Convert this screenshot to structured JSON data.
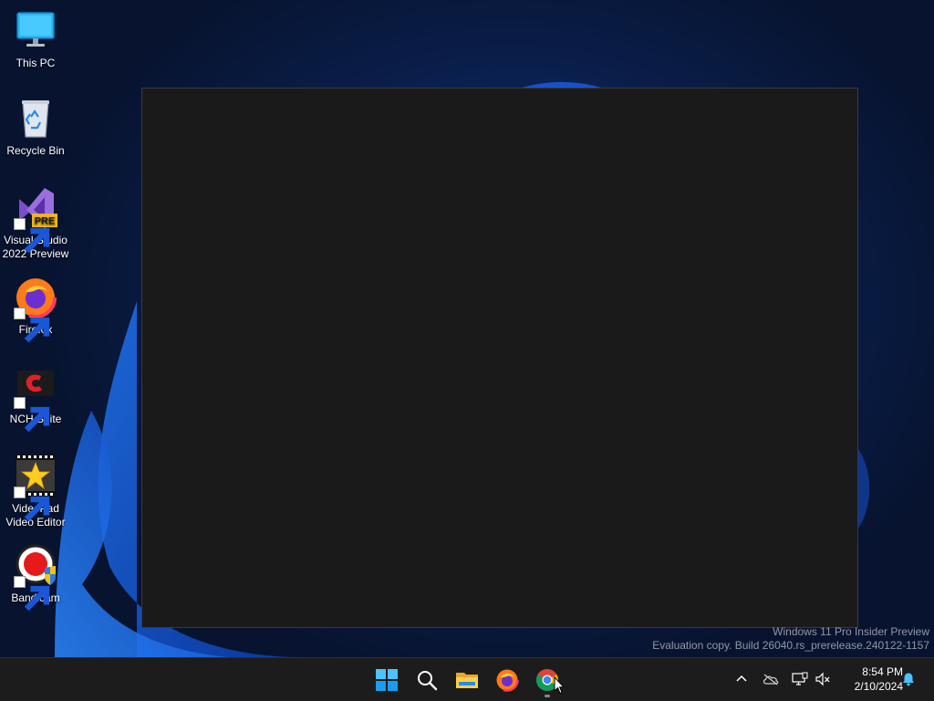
{
  "desktop": {
    "icons": [
      {
        "label": "This PC",
        "icon": "monitor-icon"
      },
      {
        "label": "Recycle Bin",
        "icon": "recycle-bin-icon"
      },
      {
        "label": "Visual Studio\n2022 Preview",
        "icon": "visual-studio-icon",
        "badge": "PRE"
      },
      {
        "label": "Firefox",
        "icon": "firefox-icon"
      },
      {
        "label": "NCH Suite",
        "icon": "nch-suite-icon"
      },
      {
        "label": "VideoPad\nVideo Editor",
        "icon": "videopad-icon"
      },
      {
        "label": "Bandicam",
        "icon": "bandicam-icon"
      }
    ]
  },
  "watermark": {
    "line1": "Windows 11 Pro Insider Preview",
    "line2": "Evaluation copy. Build 26040.rs_prerelease.240122-1157"
  },
  "taskbar": {
    "apps": [
      {
        "name": "Start",
        "icon": "windows-start-icon"
      },
      {
        "name": "Search",
        "icon": "search-icon"
      },
      {
        "name": "File Explorer",
        "icon": "folder-icon"
      },
      {
        "name": "Firefox",
        "icon": "firefox-icon"
      },
      {
        "name": "Google Chrome",
        "icon": "chrome-icon",
        "running": true
      }
    ],
    "tray": {
      "icons": [
        "chevron-up-icon",
        "onedrive-cloud-icon",
        "network-icon",
        "volume-muted-icon",
        "notification-bell-icon"
      ],
      "time": "8:54 PM",
      "date": "2/10/2024"
    }
  },
  "colors": {
    "taskbar_bg": "#1c1c1c",
    "window_bg": "#1a1a1a",
    "accent": "#0078d4"
  }
}
